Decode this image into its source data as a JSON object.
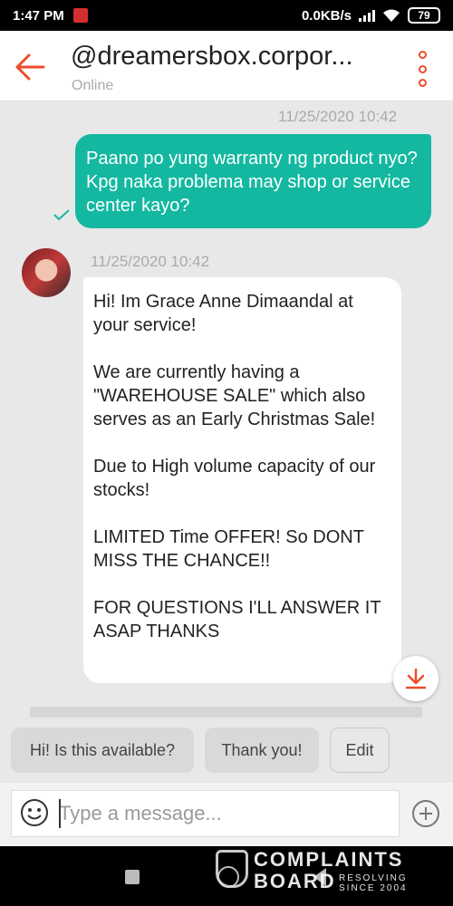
{
  "status_bar": {
    "time": "1:47 PM",
    "network_speed": "0.0KB/s",
    "battery": "79"
  },
  "header": {
    "title": "@dreamersbox.corpor...",
    "subtitle": "Online"
  },
  "messages": {
    "outgoing": {
      "timestamp": "11/25/2020 10:42",
      "text": "Paano po yung warranty ng product nyo? Kpg naka problema may shop or service center kayo?"
    },
    "incoming": {
      "timestamp": "11/25/2020 10:42",
      "paragraphs": [
        "Hi! Im Grace Anne Dimaandal at your service!",
        "We are currently having a \"WAREHOUSE SALE\" which also serves as an Early Christmas Sale!",
        "Due to High volume capacity of our stocks!",
        "LIMITED Time OFFER! So DONT MISS THE CHANCE!!",
        "FOR QUESTIONS I'LL ANSWER IT ASAP THANKS"
      ]
    }
  },
  "quick_replies": [
    "Hi! Is this available?",
    "Thank you!",
    "Edit"
  ],
  "composer": {
    "placeholder": "Type a message..."
  },
  "watermark": {
    "brand_line1": "COMPLAINTS",
    "brand_line2": "BOARD",
    "tagline_1": "RESOLVING",
    "tagline_2": "SINCE 2004"
  },
  "colors": {
    "accent": "#ee4d2d",
    "outgoing_bubble": "#14b8a1",
    "background": "#e8e8e8"
  }
}
